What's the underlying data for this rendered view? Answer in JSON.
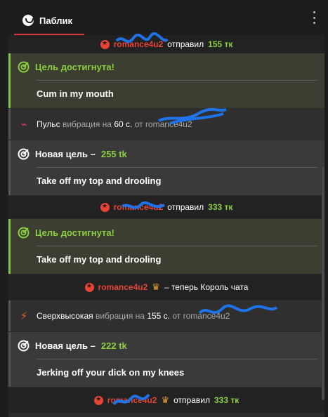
{
  "tab": {
    "label": "Паблик"
  },
  "rows": {
    "tip1": {
      "user": "romance4u2",
      "action": "отправил",
      "amount": "155 тк"
    },
    "goal1": {
      "status": "Цель достигнута!",
      "text": "Cum in my mouth"
    },
    "pulse": {
      "title": "Пульс",
      "mid": "вибрация на",
      "seconds": "60 с.",
      "from": "от",
      "user": "romance4u2"
    },
    "goal2": {
      "prefix": "Новая цель –",
      "amount": "255 tk",
      "text": "Take off my top and drooling"
    },
    "tip2": {
      "user": "romance4u2",
      "action": "отправил",
      "amount": "333 тк"
    },
    "goal3": {
      "status": "Цель достигнута!",
      "text": "Take off my top and drooling"
    },
    "king": {
      "user": "romance4u2",
      "text": "– теперь Король чата"
    },
    "ultra": {
      "title": "Сверхвысокая",
      "mid": "вибрация на",
      "seconds": "155 с.",
      "from": "от",
      "user": "romance4u2"
    },
    "goal4": {
      "prefix": "Новая цель –",
      "amount": "222 tk",
      "text": "Jerking off your dick on my knees"
    },
    "tip3": {
      "user": "romance4u2",
      "action": "отправил",
      "amount": "333 тк"
    }
  },
  "colors": {
    "accent": "#e2363f",
    "goal_green": "#8dcf3f",
    "user_red": "#e54437",
    "scribble": "#1e73e8"
  },
  "icons": [
    "chat-bubble-icon",
    "kebab-menu-icon",
    "target-icon",
    "pulse-icon",
    "lightning-icon",
    "star-badge-icon",
    "crown-icon"
  ]
}
